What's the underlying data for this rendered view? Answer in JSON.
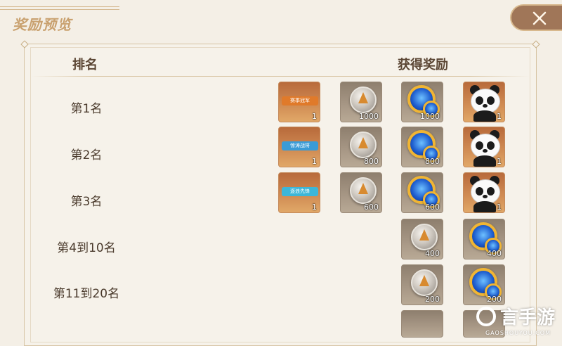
{
  "header": {
    "title": "奖励预览"
  },
  "table": {
    "col_rank": "排名",
    "col_reward": "获得奖励"
  },
  "rows": [
    {
      "rank": "第1名",
      "rewards": [
        {
          "kind": "banner",
          "banner_text": "赛季冠军",
          "color": "#e07a2a",
          "count": "1"
        },
        {
          "kind": "silver-coin",
          "count": "1000"
        },
        {
          "kind": "gem",
          "count": "1000"
        },
        {
          "kind": "panda",
          "count": "1"
        }
      ]
    },
    {
      "rank": "第2名",
      "rewards": [
        {
          "kind": "banner",
          "banner_text": "惊涛战将",
          "color": "#3a9bd6",
          "count": "1"
        },
        {
          "kind": "silver-coin",
          "count": "800"
        },
        {
          "kind": "gem",
          "count": "800"
        },
        {
          "kind": "panda",
          "count": "1"
        }
      ]
    },
    {
      "rank": "第3名",
      "rewards": [
        {
          "kind": "banner",
          "banner_text": "逐浪先锋",
          "color": "#3cb6d8",
          "count": "1"
        },
        {
          "kind": "silver-coin",
          "count": "600"
        },
        {
          "kind": "gem",
          "count": "600"
        },
        {
          "kind": "panda",
          "count": "1"
        }
      ]
    },
    {
      "rank": "第4到10名",
      "rewards": [
        {
          "kind": "silver-coin",
          "count": "400"
        },
        {
          "kind": "gem",
          "count": "400"
        }
      ]
    },
    {
      "rank": "第11到20名",
      "rewards": [
        {
          "kind": "silver-coin",
          "count": "200"
        },
        {
          "kind": "gem",
          "count": "200"
        }
      ]
    }
  ],
  "watermark": {
    "text": "言手游",
    "sub": "GAOSHOUYOU.COM"
  }
}
